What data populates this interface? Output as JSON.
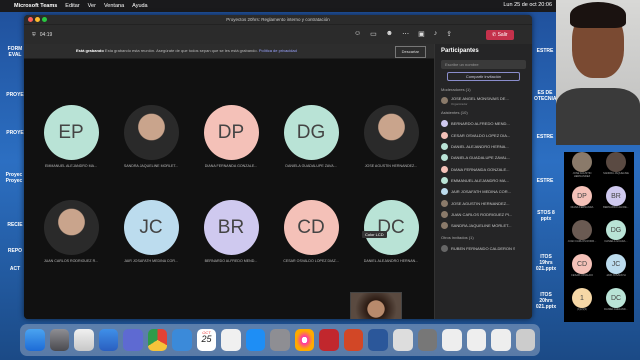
{
  "menubar": {
    "app": "Microsoft Teams",
    "items": [
      "Editar",
      "Ver",
      "Ventana",
      "Ayuda"
    ],
    "clock": "Lun 25 de oct 20:06"
  },
  "window": {
    "title": "Proyectos 20hrs: Reglamento interno y contratación",
    "timer": "04:19",
    "leave_label": "Salir"
  },
  "banner": {
    "title": "Está grabando",
    "text": "Esta grabando esta reunión. Asegúrate de que todos sepan que se les está grabando.",
    "link": "Política de privacidad",
    "dismiss": "Descartar"
  },
  "stage": {
    "tiles": [
      {
        "initials": "EP",
        "name": "EMMANUEL ALEJANDRO MA...",
        "color": "#b9e3d6"
      },
      {
        "initials": "",
        "name": "SANDRA JAQUELINE MORLET...",
        "color": ""
      },
      {
        "initials": "DP",
        "name": "DIANA FERNANDA GONZALE...",
        "color": "#f4c1b8"
      },
      {
        "initials": "DG",
        "name": "DANIELA GUADALUPE ZAVA...",
        "color": "#b9e3d6"
      },
      {
        "initials": "",
        "name": "JOSE AGUSTIN HERNANDEZ...",
        "color": ""
      },
      {
        "initials": "",
        "name": "JUAN CARLOS RODRIGUEZ R...",
        "color": ""
      },
      {
        "initials": "JC",
        "name": "JAIR JOSAFATH MEDINA COR...",
        "color": "#bcdcee"
      },
      {
        "initials": "BR",
        "name": "BERNARDO ALFREDO MEND...",
        "color": "#cfc9ef"
      },
      {
        "initials": "CD",
        "name": "CESAR OSVALDO LOPEZ DIAZ...",
        "color": "#f4c1b8"
      },
      {
        "initials": "DC",
        "name": "DANIEL ALEJANDRO HERNAN...",
        "color": "#b9e3d6"
      }
    ],
    "tooltip": "Color LCD"
  },
  "panel": {
    "title": "Participantes",
    "search_placeholder": "Escribe un nombre",
    "share_label": "Compartir invitación",
    "moderators_header": "Moderadores (1)",
    "moderator": {
      "name": "JOSE ANGEL MONSIVAIS DE...",
      "role": "Organizador"
    },
    "attendees_header": "Asistentes (10)",
    "attendees": [
      "BERNARDO ALFREDO MEND...",
      "CESAR OSVALDO LOPEZ DIA...",
      "DANIEL ALEJANDRO HERNA...",
      "DANIELA GUADALUPE ZAVAL...",
      "DIANA FERNANDA GONZALE...",
      "EMMANUEL ALEJANDRO MA...",
      "JAIR JOSAFATH MEDINA COR...",
      "JOSE AGUSTIN HERNANDEZ...",
      "JUAN CARLOS RODRIGUEZ PI...",
      "SANDRA JAQUELINE MORLET..."
    ],
    "others_header": "Otros invitados (1)",
    "other": "RUBEN FERNANDO CALDERON S..."
  },
  "dock": {
    "calendar_month": "OCT",
    "calendar_day": "25"
  },
  "desktop_labels": [
    "FORM EVAL",
    "PROYE",
    "PROYE",
    "Proyec Proyec",
    "RECIE",
    "REPO",
    "ACT",
    "ESTRE",
    "ES DE OTECNIA",
    "ESTRE",
    "ESTRE",
    "STOS 8 pptx",
    "ITOS 19hrs 021.pptx",
    "ITOS 20hrs 021.pptx"
  ],
  "mini_grid": [
    {
      "label": "",
      "name": "JOSE AGUSTIN HERNANDEZ"
    },
    {
      "label": "",
      "name": "SANDRA JAQUELINE"
    },
    {
      "label": "DP",
      "name": "DIANA FERNANDA"
    },
    {
      "label": "BR",
      "name": "BERNARDO ALFRE..."
    },
    {
      "label": "",
      "name": "JUAN CARLOS RODR..."
    },
    {
      "label": "DG",
      "name": "DANIELA GUADA..."
    },
    {
      "label": "CD",
      "name": "CESAR OSVALDO"
    },
    {
      "label": "JC",
      "name": "JAIR JOSAFATH"
    },
    {
      "label": "1",
      "name": "(1)(2)(3)"
    },
    {
      "label": "DC",
      "name": "DANIEL ALEJAND..."
    }
  ]
}
